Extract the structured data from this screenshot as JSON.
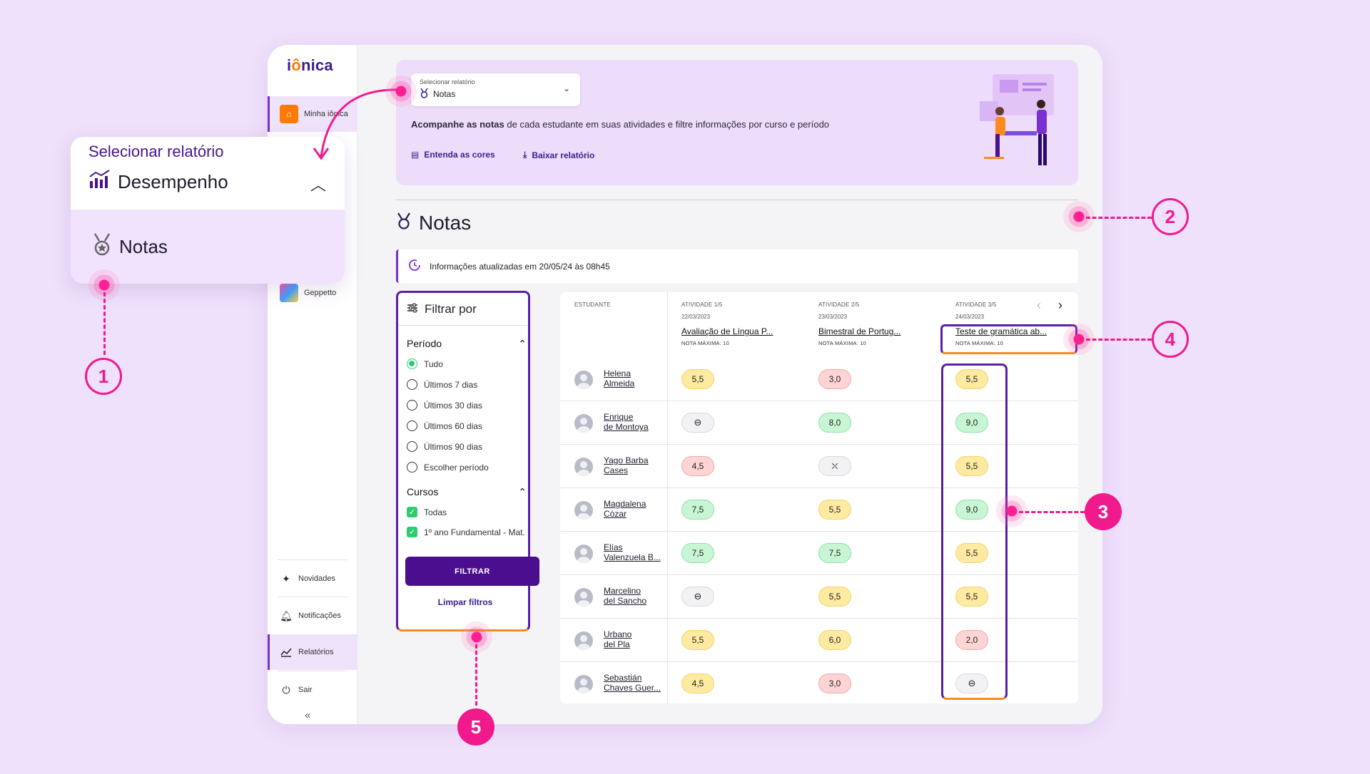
{
  "app": {
    "logo": "iônica"
  },
  "sidebar": {
    "items": [
      {
        "label": "Minha iônica",
        "icon": "home-icon"
      },
      {
        "label": "Geppetto",
        "icon": "avatar-icon"
      },
      {
        "label": "Novidades",
        "icon": "sparkle-icon"
      },
      {
        "label": "Notificações",
        "icon": "bell-icon"
      },
      {
        "label": "Relatórios",
        "icon": "chart-icon"
      },
      {
        "label": "Sair",
        "icon": "power-icon"
      }
    ],
    "collapse": "«"
  },
  "banner": {
    "select_label": "Selecionar relatório",
    "select_value": "Notas",
    "desc_bold": "Acompanhe as notas",
    "desc_rest": " de cada estudante em suas atividades e filtre informações por curso e período",
    "link_colors": "Entenda as cores",
    "link_download": "Baixar relatório"
  },
  "page": {
    "title": "Notas",
    "updated": "Informações atualizadas em 20/05/24 às 08h45"
  },
  "filter": {
    "title": "Filtrar por",
    "period_title": "Período",
    "period_options": [
      "Tudo",
      "Últimos 7 dias",
      "Últimos 30 dias",
      "Últimos 60 dias",
      "Últimos 90 dias",
      "Escolher período"
    ],
    "courses_title": "Cursos",
    "course_options": [
      "Todas",
      "1º ano Fundamental - Mat."
    ],
    "filter_button": "FILTRAR",
    "clear_button": "Limpar filtros"
  },
  "table": {
    "student_header": "ESTUDANTE",
    "activities": [
      {
        "num": "ATIVIDADE 1/5",
        "date": "22/03/2023",
        "title": "Avaliação de Língua P...",
        "max": "NOTA MÁXIMA: 10"
      },
      {
        "num": "ATIVIDADE 2/5",
        "date": "23/03/2023",
        "title": "Bimestral de Portug...",
        "max": "NOTA MÁXIMA: 10"
      },
      {
        "num": "ATIVIDADE 3/5",
        "date": "24/03/2023",
        "title": "Teste de gramática ab...",
        "max": "NOTA MÁXIMA: 10"
      }
    ],
    "rows": [
      {
        "name1": "Helena",
        "name2": "Almeida",
        "grades": [
          "5,5",
          "3,0",
          "5,5"
        ],
        "colors": [
          "yellow",
          "red",
          "yellow"
        ]
      },
      {
        "name1": "Enrique",
        "name2": "de Montoya",
        "grades": [
          "⊖",
          "8,0",
          "9,0"
        ],
        "colors": [
          "empty",
          "green",
          "green"
        ]
      },
      {
        "name1": "Yago Barba",
        "name2": "Cases",
        "grades": [
          "4,5",
          "⛌",
          "5,5"
        ],
        "colors": [
          "red",
          "absent",
          "yellow"
        ]
      },
      {
        "name1": "Magdalena",
        "name2": "Cózar",
        "grades": [
          "7,5",
          "5,5",
          "9,0"
        ],
        "colors": [
          "green",
          "yellow",
          "green"
        ]
      },
      {
        "name1": "Elías",
        "name2": "Valenzuela B...",
        "grades": [
          "7,5",
          "7,5",
          "5,5"
        ],
        "colors": [
          "green",
          "green",
          "yellow"
        ]
      },
      {
        "name1": "Marcelino",
        "name2": "del Sancho",
        "grades": [
          "⊖",
          "5,5",
          "5,5"
        ],
        "colors": [
          "empty",
          "yellow",
          "yellow"
        ]
      },
      {
        "name1": "Urbano",
        "name2": "del Pla",
        "grades": [
          "5,5",
          "6,0",
          "2,0"
        ],
        "colors": [
          "yellow",
          "yellow",
          "red"
        ]
      },
      {
        "name1": "Sebastián",
        "name2": "Chaves Guer...",
        "grades": [
          "4,5",
          "3,0",
          "⊖"
        ],
        "colors": [
          "yellow",
          "red",
          "empty"
        ]
      }
    ]
  },
  "zoom": {
    "label": "Selecionar relatório",
    "selected": "Desempenho",
    "option": "Notas"
  },
  "callouts": [
    "1",
    "2",
    "3",
    "4",
    "5"
  ],
  "colors": {
    "accent": "#f01a8c",
    "primary": "#4a0e8f",
    "banner": "#eedcfb"
  }
}
